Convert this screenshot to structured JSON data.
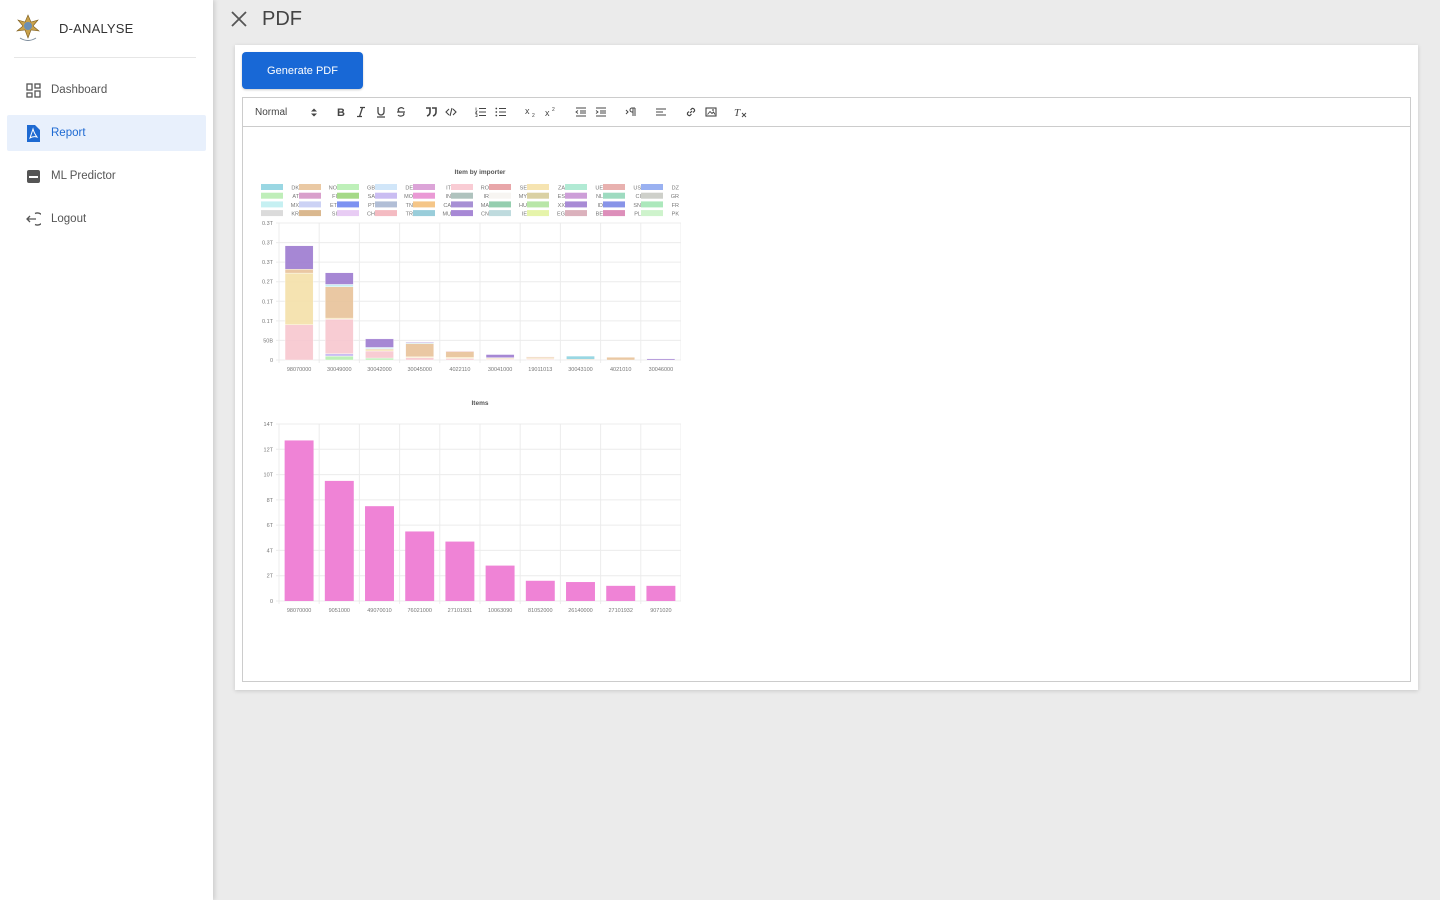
{
  "brand": {
    "name": "D-ANALYSE",
    "logo_icon": "emblem-logo"
  },
  "nav": {
    "items": [
      {
        "label": "Dashboard",
        "icon": "dashboard-icon",
        "active": false
      },
      {
        "label": "Report",
        "icon": "pdf-file-icon",
        "active": true
      },
      {
        "label": "ML Predictor",
        "icon": "predictor-icon",
        "active": false
      },
      {
        "label": "Logout",
        "icon": "logout-icon",
        "active": false
      }
    ]
  },
  "header": {
    "title": "PDF",
    "close_icon": "close-icon"
  },
  "actions": {
    "generate_label": "Generate PDF"
  },
  "editor_toolbar": {
    "format_select": "Normal",
    "buttons": [
      "bold",
      "italic",
      "underline",
      "strike",
      "blockquote",
      "code-block",
      "ordered-list",
      "bullet-list",
      "subscript",
      "superscript",
      "outdent",
      "indent",
      "text-direction",
      "align",
      "link",
      "image",
      "clean"
    ]
  },
  "colors": {
    "accent": "#1868d6",
    "active_bg": "#e8f0fc",
    "bar_pink": "#ef83d6"
  },
  "chart_data": [
    {
      "type": "bar",
      "stacked": true,
      "title": "Item by importer",
      "legend_position": "top",
      "legend": [
        "DK",
        "NO",
        "GB",
        "DE",
        "IT",
        "RO",
        "SE",
        "ZA",
        "UE",
        "US",
        "DZ",
        "AT",
        "FI",
        "SA",
        "MO",
        "IN",
        "IR",
        "MY",
        "ES",
        "NL",
        "CI",
        "GR",
        "MX",
        "ET",
        "PT",
        "TN",
        "CA",
        "MA",
        "HU",
        "XX",
        "ID",
        "SN",
        "FR",
        "KR",
        "SI",
        "CH",
        "TR",
        "MU",
        "CN",
        "IE",
        "EG",
        "BE",
        "PL",
        "PK"
      ],
      "legend_colors": [
        "#8fd3e0",
        "#e8c39a",
        "#b7eeb1",
        "#cce3f8",
        "#d89ad4",
        "#f8c7cf",
        "#e59ca0",
        "#f5e1a9",
        "#a9e8cf",
        "#e6a9a6",
        "#8fa8f0",
        "#b8ecb1",
        "#d596c6",
        "#9bd57a",
        "#c4b6f1",
        "#e88fd0",
        "#a6bdb7",
        "#f6f4f1",
        "#d6cc9a",
        "#c894d4",
        "#93d7b9",
        "#c9cbc4",
        "#c0eef1",
        "#c6cdf4",
        "#6f86ef",
        "#a9b7d2",
        "#f4c07b",
        "#9d84cf",
        "#89c9a6",
        "#b0e39e",
        "#9f7ed0",
        "#7b88e6",
        "#a3e6b5",
        "#d7d7d7",
        "#d6b083",
        "#e5c6f3",
        "#f3b4bb",
        "#8ec8d6",
        "#9d7bd0",
        "#b8d7da",
        "#e3f3a1",
        "#d7a8b5",
        "#d983b3",
        "#c9f2c6"
      ],
      "categories": [
        "98070000",
        "30049000",
        "30042000",
        "30045000",
        "4022110",
        "30041000",
        "19011013",
        "30043100",
        "4021010",
        "30046000"
      ],
      "y_tick_labels": [
        "0",
        "50B",
        "0.1T",
        "0.1T",
        "0.2T",
        "0.3T",
        "0.3T",
        "0.3T"
      ],
      "series": [
        {
          "name": "GB",
          "values": [
            0,
            0.01,
            0.005,
            0,
            0,
            0,
            0,
            0,
            0,
            0
          ]
        },
        {
          "name": "MO",
          "values": [
            0,
            0.006,
            0,
            0,
            0,
            0,
            0,
            0,
            0,
            0
          ]
        },
        {
          "name": "RO",
          "values": [
            0.09,
            0.088,
            0.018,
            0.006,
            0.004,
            0.002,
            0.002,
            0,
            0,
            0
          ]
        },
        {
          "name": "ZA",
          "values": [
            0.132,
            0.003,
            0.003,
            0.002,
            0.003,
            0.002,
            0.002,
            0,
            0,
            0
          ]
        },
        {
          "name": "NO",
          "values": [
            0.01,
            0.08,
            0.003,
            0.034,
            0.014,
            0.002,
            0.003,
            0.002,
            0.007,
            0
          ]
        },
        {
          "name": "MX",
          "values": [
            0,
            0.006,
            0.003,
            0.002,
            0,
            0,
            0,
            0,
            0,
            0
          ]
        },
        {
          "name": "US",
          "values": [
            0,
            0,
            0,
            0,
            0.002,
            0,
            0.001,
            0,
            0,
            0
          ]
        },
        {
          "name": "DK",
          "values": [
            0,
            0,
            0,
            0,
            0,
            0,
            0,
            0.008,
            0,
            0
          ]
        },
        {
          "name": "CN",
          "values": [
            0.06,
            0.03,
            0.022,
            0.002,
            0,
            0.008,
            0,
            0,
            0,
            0.003
          ]
        }
      ]
    },
    {
      "type": "bar",
      "title": "Items",
      "categories": [
        "98070000",
        "9051000",
        "49070010",
        "76021000",
        "27101931",
        "10063090",
        "81052000",
        "26140000",
        "27101932",
        "9071020"
      ],
      "values": [
        12.7,
        9.5,
        7.5,
        5.5,
        4.7,
        2.8,
        1.6,
        1.5,
        1.2,
        1.2
      ],
      "ylim": [
        0,
        14
      ],
      "y_tick_labels": [
        "0",
        "2T",
        "4T",
        "6T",
        "8T",
        "10T",
        "12T",
        "14T"
      ]
    }
  ]
}
